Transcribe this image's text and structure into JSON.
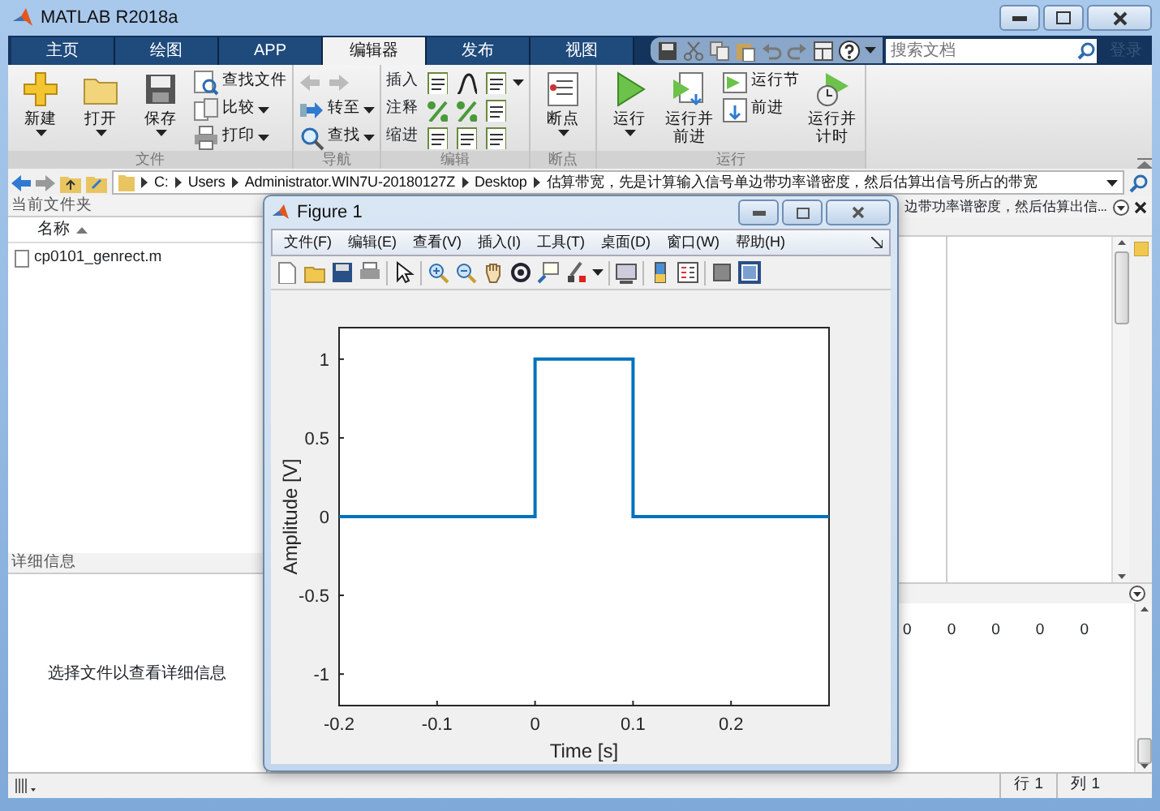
{
  "window": {
    "title": "MATLAB R2018a"
  },
  "tabs": [
    {
      "label": "主页",
      "selected": false
    },
    {
      "label": "绘图",
      "selected": false
    },
    {
      "label": "APP",
      "selected": false
    },
    {
      "label": "编辑器",
      "selected": true
    },
    {
      "label": "发布",
      "selected": false
    },
    {
      "label": "视图",
      "selected": false
    }
  ],
  "search": {
    "placeholder": "搜索文档"
  },
  "sign_in": "登录",
  "ribbon": {
    "groups": [
      {
        "label": "文件",
        "items": [
          {
            "kind": "large",
            "label": "新建",
            "dropdown": true
          },
          {
            "kind": "large",
            "label": "打开",
            "dropdown": true
          },
          {
            "kind": "large",
            "label": "保存",
            "dropdown": true
          },
          {
            "kind": "small",
            "label": "查找文件",
            "dropdown": false
          },
          {
            "kind": "small",
            "label": "比较",
            "dropdown": true
          },
          {
            "kind": "small",
            "label": "打印",
            "dropdown": true
          }
        ]
      },
      {
        "label": "导航",
        "items": [
          {
            "kind": "arrows",
            "disabled": true
          },
          {
            "kind": "small",
            "label": "转至",
            "dropdown": true
          },
          {
            "kind": "small",
            "label": "查找",
            "dropdown": true
          }
        ]
      },
      {
        "label": "编辑",
        "items": [
          {
            "kind": "row",
            "label": "插入",
            "dropdown": true
          },
          {
            "kind": "row",
            "label": "注释",
            "dropdown": false
          },
          {
            "kind": "row",
            "label": "缩进",
            "dropdown": false
          }
        ]
      },
      {
        "label": "断点",
        "items": [
          {
            "kind": "large",
            "label": "断点",
            "dropdown": true
          }
        ]
      },
      {
        "label": "运行",
        "items": [
          {
            "kind": "large",
            "label": "运行",
            "dropdown": true
          },
          {
            "kind": "large",
            "label": "运行并前进",
            "dropdown": false
          },
          {
            "kind": "small",
            "label": "运行节",
            "dropdown": false
          },
          {
            "kind": "small",
            "label": "前进",
            "dropdown": false
          },
          {
            "kind": "large",
            "label": "运行并计时",
            "dropdown": false
          }
        ]
      }
    ]
  },
  "address": {
    "crumbs": [
      "C:",
      "Users",
      "Administrator.WIN7U-20180127Z",
      "Desktop",
      "估算带宽，先是计算输入信号单边带功率谱密度，然后估算出信号所占的带宽"
    ]
  },
  "current_folder": {
    "title": "当前文件夹",
    "column": "名称",
    "files": [
      "cp0101_genrect.m"
    ]
  },
  "details": {
    "title": "详细信息",
    "message": "选择文件以查看详细信息"
  },
  "editor": {
    "tab_title": "边带功率谱密度，然后估算出信..."
  },
  "command_window": {
    "values": [
      "0",
      "0",
      "0",
      "0",
      "0"
    ]
  },
  "status_bar": {
    "row": "行  1",
    "column": "列  1"
  },
  "figure": {
    "title": "Figure 1",
    "menu": [
      "文件(F)",
      "编辑(E)",
      "查看(V)",
      "插入(I)",
      "工具(T)",
      "桌面(D)",
      "窗口(W)",
      "帮助(H)"
    ],
    "chart_data": {
      "type": "line",
      "xlabel": "Time [s]",
      "ylabel": "Amplitude [V]",
      "xlim": [
        -0.2,
        0.3
      ],
      "ylim": [
        -1.2,
        1.2
      ],
      "xticks": [
        -0.2,
        -0.1,
        0,
        0.1,
        0.2
      ],
      "yticks": [
        -1,
        -0.5,
        0,
        0.5,
        1
      ],
      "x": [
        -0.2,
        0,
        0,
        0.1,
        0.1,
        0.3
      ],
      "series": [
        {
          "color": "#0072bd",
          "values": [
            0,
            0,
            1,
            1,
            0,
            0
          ]
        }
      ]
    }
  }
}
